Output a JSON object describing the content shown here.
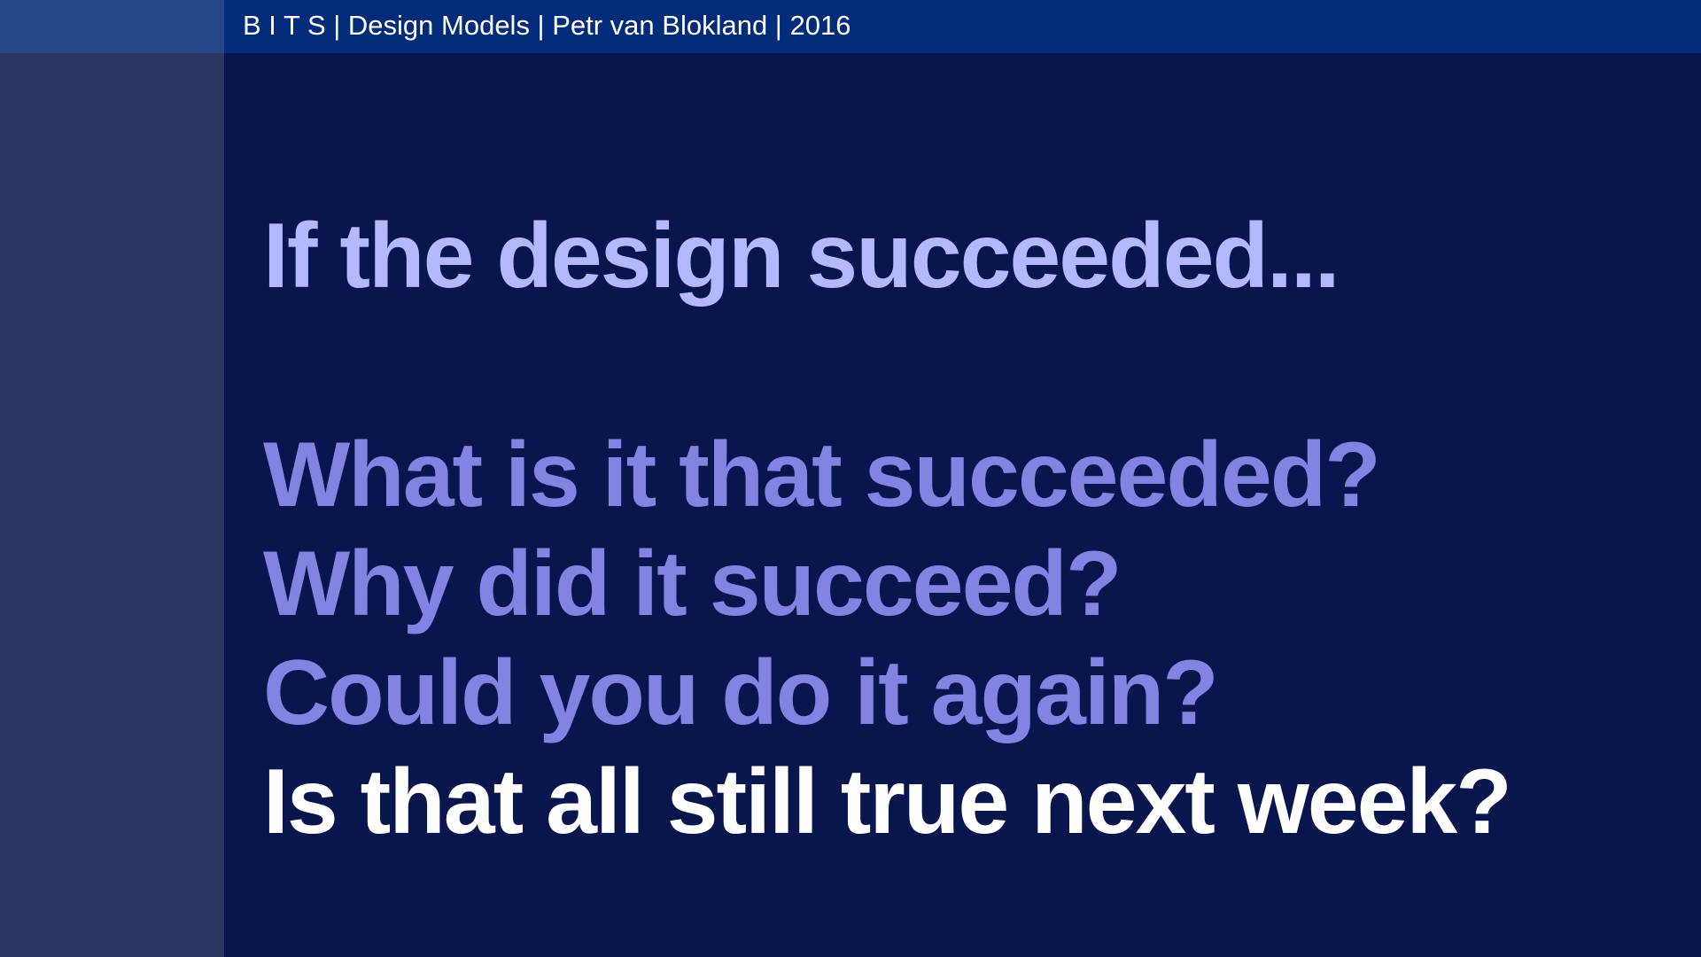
{
  "header": {
    "text": "B I T S | Design Models | Petr van Blokland | 2016"
  },
  "slide": {
    "lines": [
      "If the design succeeded...",
      "What is it that succeeded?",
      "Why did it succeed?",
      "Could you do it again?",
      "Is that all still true next week?"
    ]
  },
  "colors": {
    "background": "#08164d",
    "top_bar": "#022c7a",
    "top_bar_left_block": "#26468a",
    "sidebar": "#2a3561",
    "line_light": "#b3b8ff",
    "line_medium": "#8284e2",
    "line_emphasis": "#ffffff"
  }
}
